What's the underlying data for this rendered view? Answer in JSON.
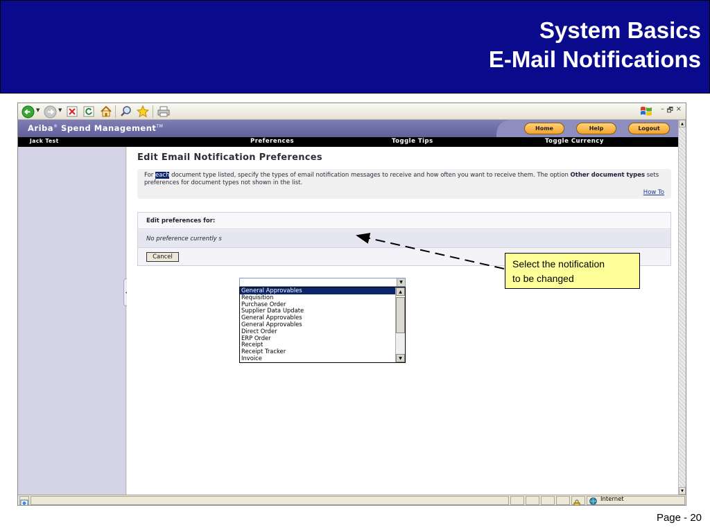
{
  "slide": {
    "title_line1": "System Basics",
    "title_line2": "E-Mail Notifications",
    "page_label": "Page - 20"
  },
  "browser": {
    "toolbar_icons": [
      "back-icon",
      "forward-icon",
      "stop-icon",
      "refresh-icon",
      "home-icon",
      "search-icon",
      "favorites-icon",
      "print-icon"
    ],
    "window_controls": [
      "–",
      "🗗",
      "×"
    ],
    "status_zone": "Internet"
  },
  "ariba": {
    "logo": "Ariba",
    "logo_suffix": "Spend Management",
    "tm": "TM",
    "header_buttons": [
      "Home",
      "Help",
      "Logout"
    ],
    "user": "Jack Test",
    "nav": [
      "Preferences",
      "Toggle Tips",
      "Toggle Currency"
    ]
  },
  "page": {
    "title": "Edit Email Notification Preferences",
    "info_pre": "For ",
    "info_highlight": "each",
    "info_mid": " document type listed, specify the types of email notification messages to receive and how often you want to receive them. The option ",
    "info_bold": "Other document types",
    "info_post": " sets preferences for document types not shown in the list.",
    "how_to": "How To",
    "edit_label": "Edit preferences for:",
    "no_pref": "No preference currently s",
    "cancel": "Cancel",
    "dropdown_options": [
      "General Approvables",
      "Requisition",
      "Purchase Order",
      "Supplier Data Update",
      "General Approvables",
      "General Approvables",
      "Direct Order",
      "ERP Order",
      "Receipt",
      "Receipt Tracker",
      "Invoice"
    ],
    "selected_index": 0
  },
  "callout": {
    "line1": "Select the notification",
    "line2": "to be changed"
  },
  "colors": {
    "slide_header": "#0a0a8c",
    "ariba_bar": "#6f6fa8",
    "selection": "#0b246a",
    "callout_bg": "#ffff99",
    "button_orange": "#f3a22a"
  }
}
